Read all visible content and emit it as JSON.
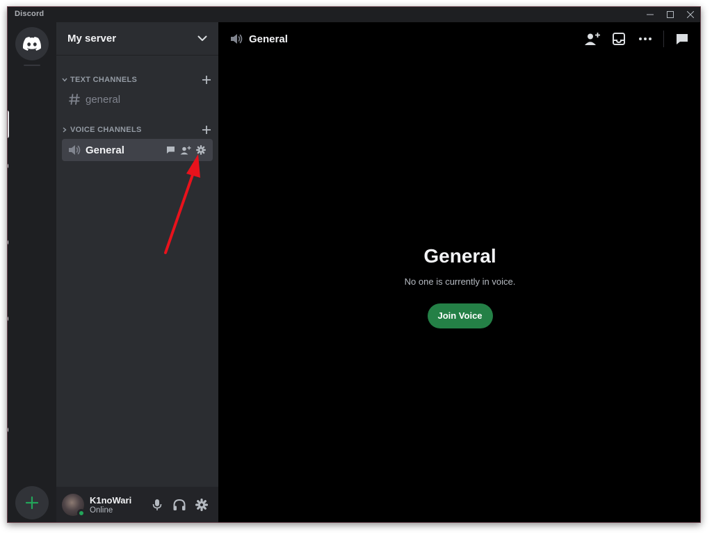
{
  "window": {
    "app_name": "Discord"
  },
  "rail": {
    "home_icon": "discord-logo-icon",
    "add_icon": "plus-icon"
  },
  "sidebar": {
    "server_name": "My server",
    "categories": [
      {
        "label": "TEXT CHANNELS"
      },
      {
        "label": "VOICE CHANNELS"
      }
    ],
    "channels": [
      {
        "name": "general",
        "type": "text",
        "icon": "hash-icon"
      },
      {
        "name": "General",
        "type": "voice",
        "icon": "speaker-icon",
        "actions": [
          "chat-icon",
          "invite-icon",
          "gear-icon"
        ]
      }
    ]
  },
  "user": {
    "name": "K1noWari",
    "status": "Online"
  },
  "main": {
    "header_title": "General",
    "voice_title": "General",
    "voice_subtitle": "No one is currently in voice.",
    "join_label": "Join Voice"
  },
  "colors": {
    "accent_green": "#248046",
    "online": "#23a55a",
    "annotation_arrow": "#e8121c"
  }
}
